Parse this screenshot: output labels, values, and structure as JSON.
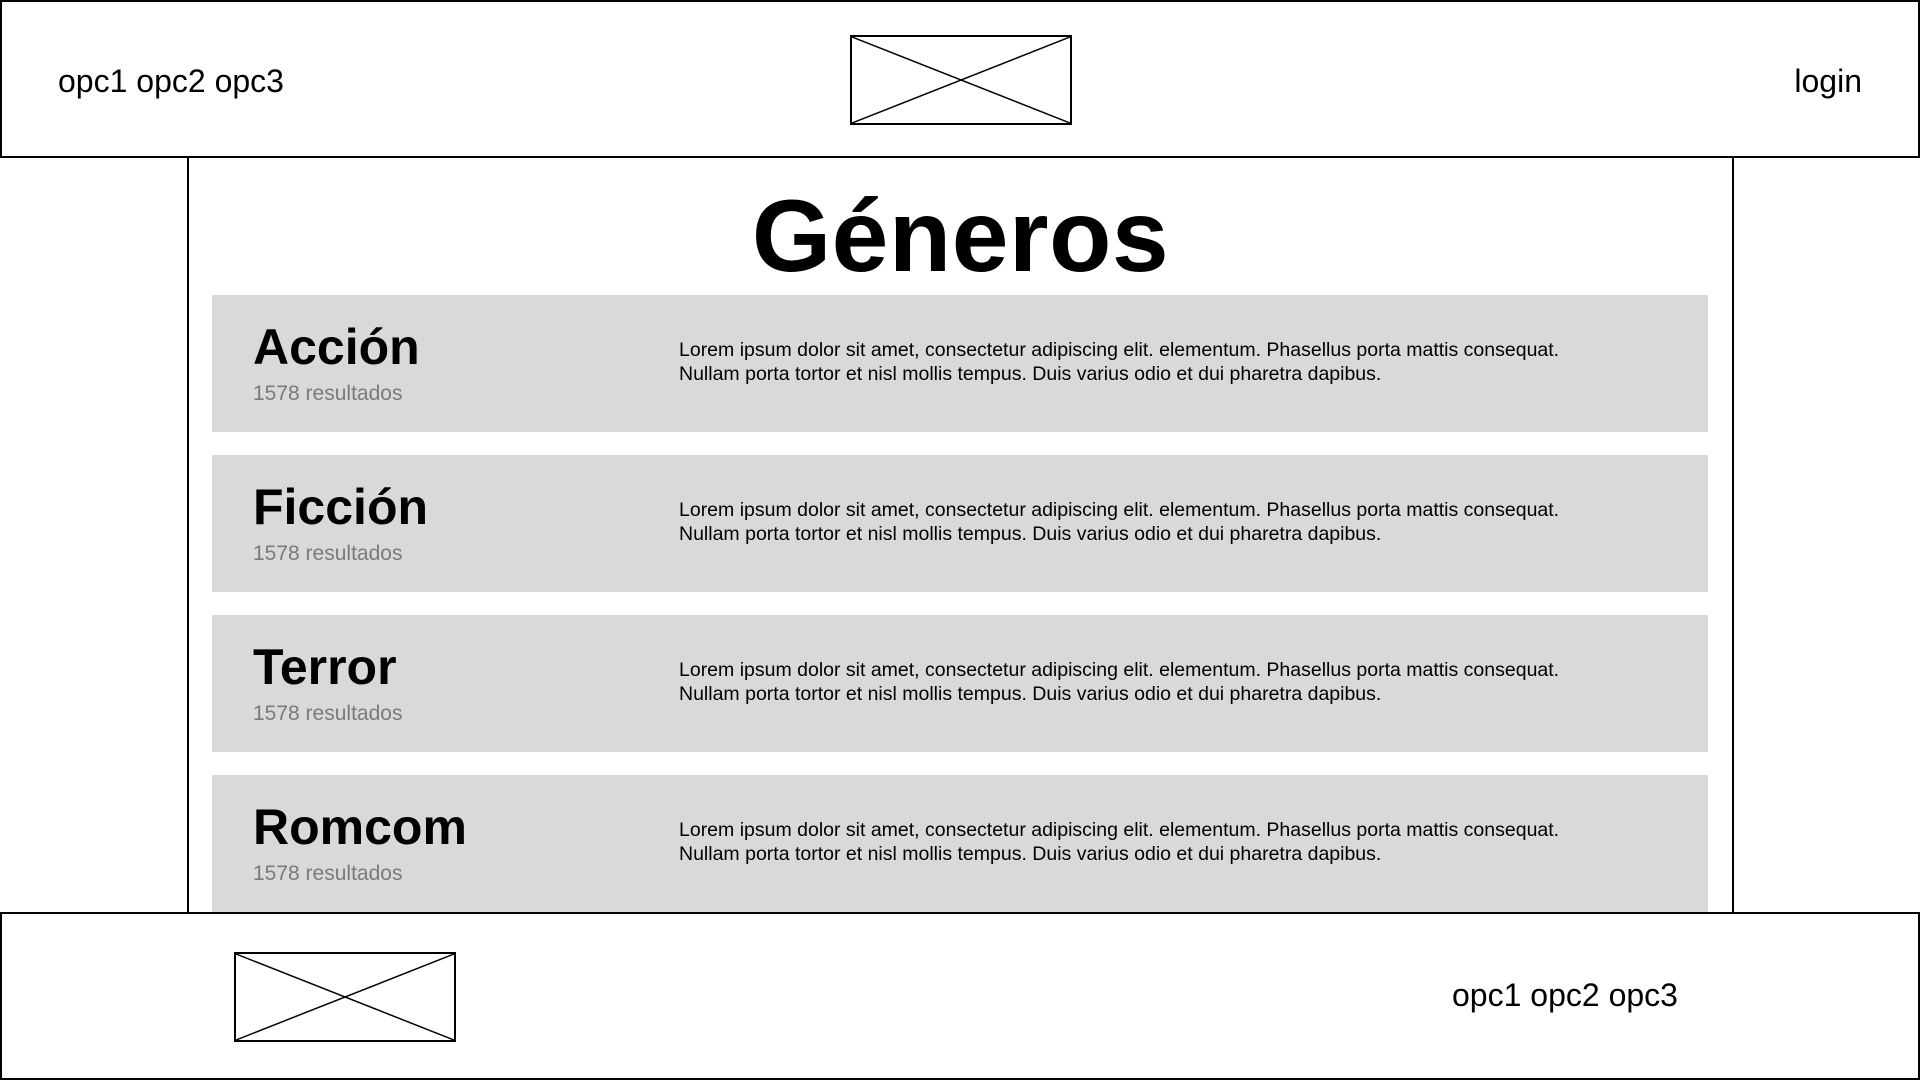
{
  "header": {
    "nav": [
      "opc1",
      "opc2",
      "opc3"
    ],
    "login_label": "login",
    "logo_icon": "image-placeholder-icon"
  },
  "main": {
    "title": "Géneros",
    "genres": [
      {
        "name": "Acción",
        "count": "1578 resultados",
        "description_line1": "Lorem ipsum dolor sit amet, consectetur adipiscing elit. elementum. Phasellus porta mattis consequat.",
        "description_line2": "Nullam porta tortor et nisl mollis tempus.  Duis varius odio et dui pharetra dapibus."
      },
      {
        "name": "Ficción",
        "count": "1578 resultados",
        "description_line1": "Lorem ipsum dolor sit amet, consectetur adipiscing elit. elementum. Phasellus porta mattis consequat.",
        "description_line2": "Nullam porta tortor et nisl mollis tempus.  Duis varius odio et dui pharetra dapibus."
      },
      {
        "name": "Terror",
        "count": "1578 resultados",
        "description_line1": "Lorem ipsum dolor sit amet, consectetur adipiscing elit. elementum. Phasellus porta mattis consequat.",
        "description_line2": "Nullam porta tortor et nisl mollis tempus.  Duis varius odio et dui pharetra dapibus."
      },
      {
        "name": "Romcom",
        "count": "1578 resultados",
        "description_line1": "Lorem ipsum dolor sit amet, consectetur adipiscing elit. elementum. Phasellus porta mattis consequat.",
        "description_line2": "Nullam porta tortor et nisl mollis tempus.  Duis varius odio et dui pharetra dapibus."
      }
    ]
  },
  "footer": {
    "nav": [
      "opc1",
      "opc2",
      "opc3"
    ],
    "logo_icon": "image-placeholder-icon"
  },
  "colors": {
    "card_background": "#d9d9d9",
    "muted_text": "#7a7a7a",
    "border": "#000000"
  }
}
